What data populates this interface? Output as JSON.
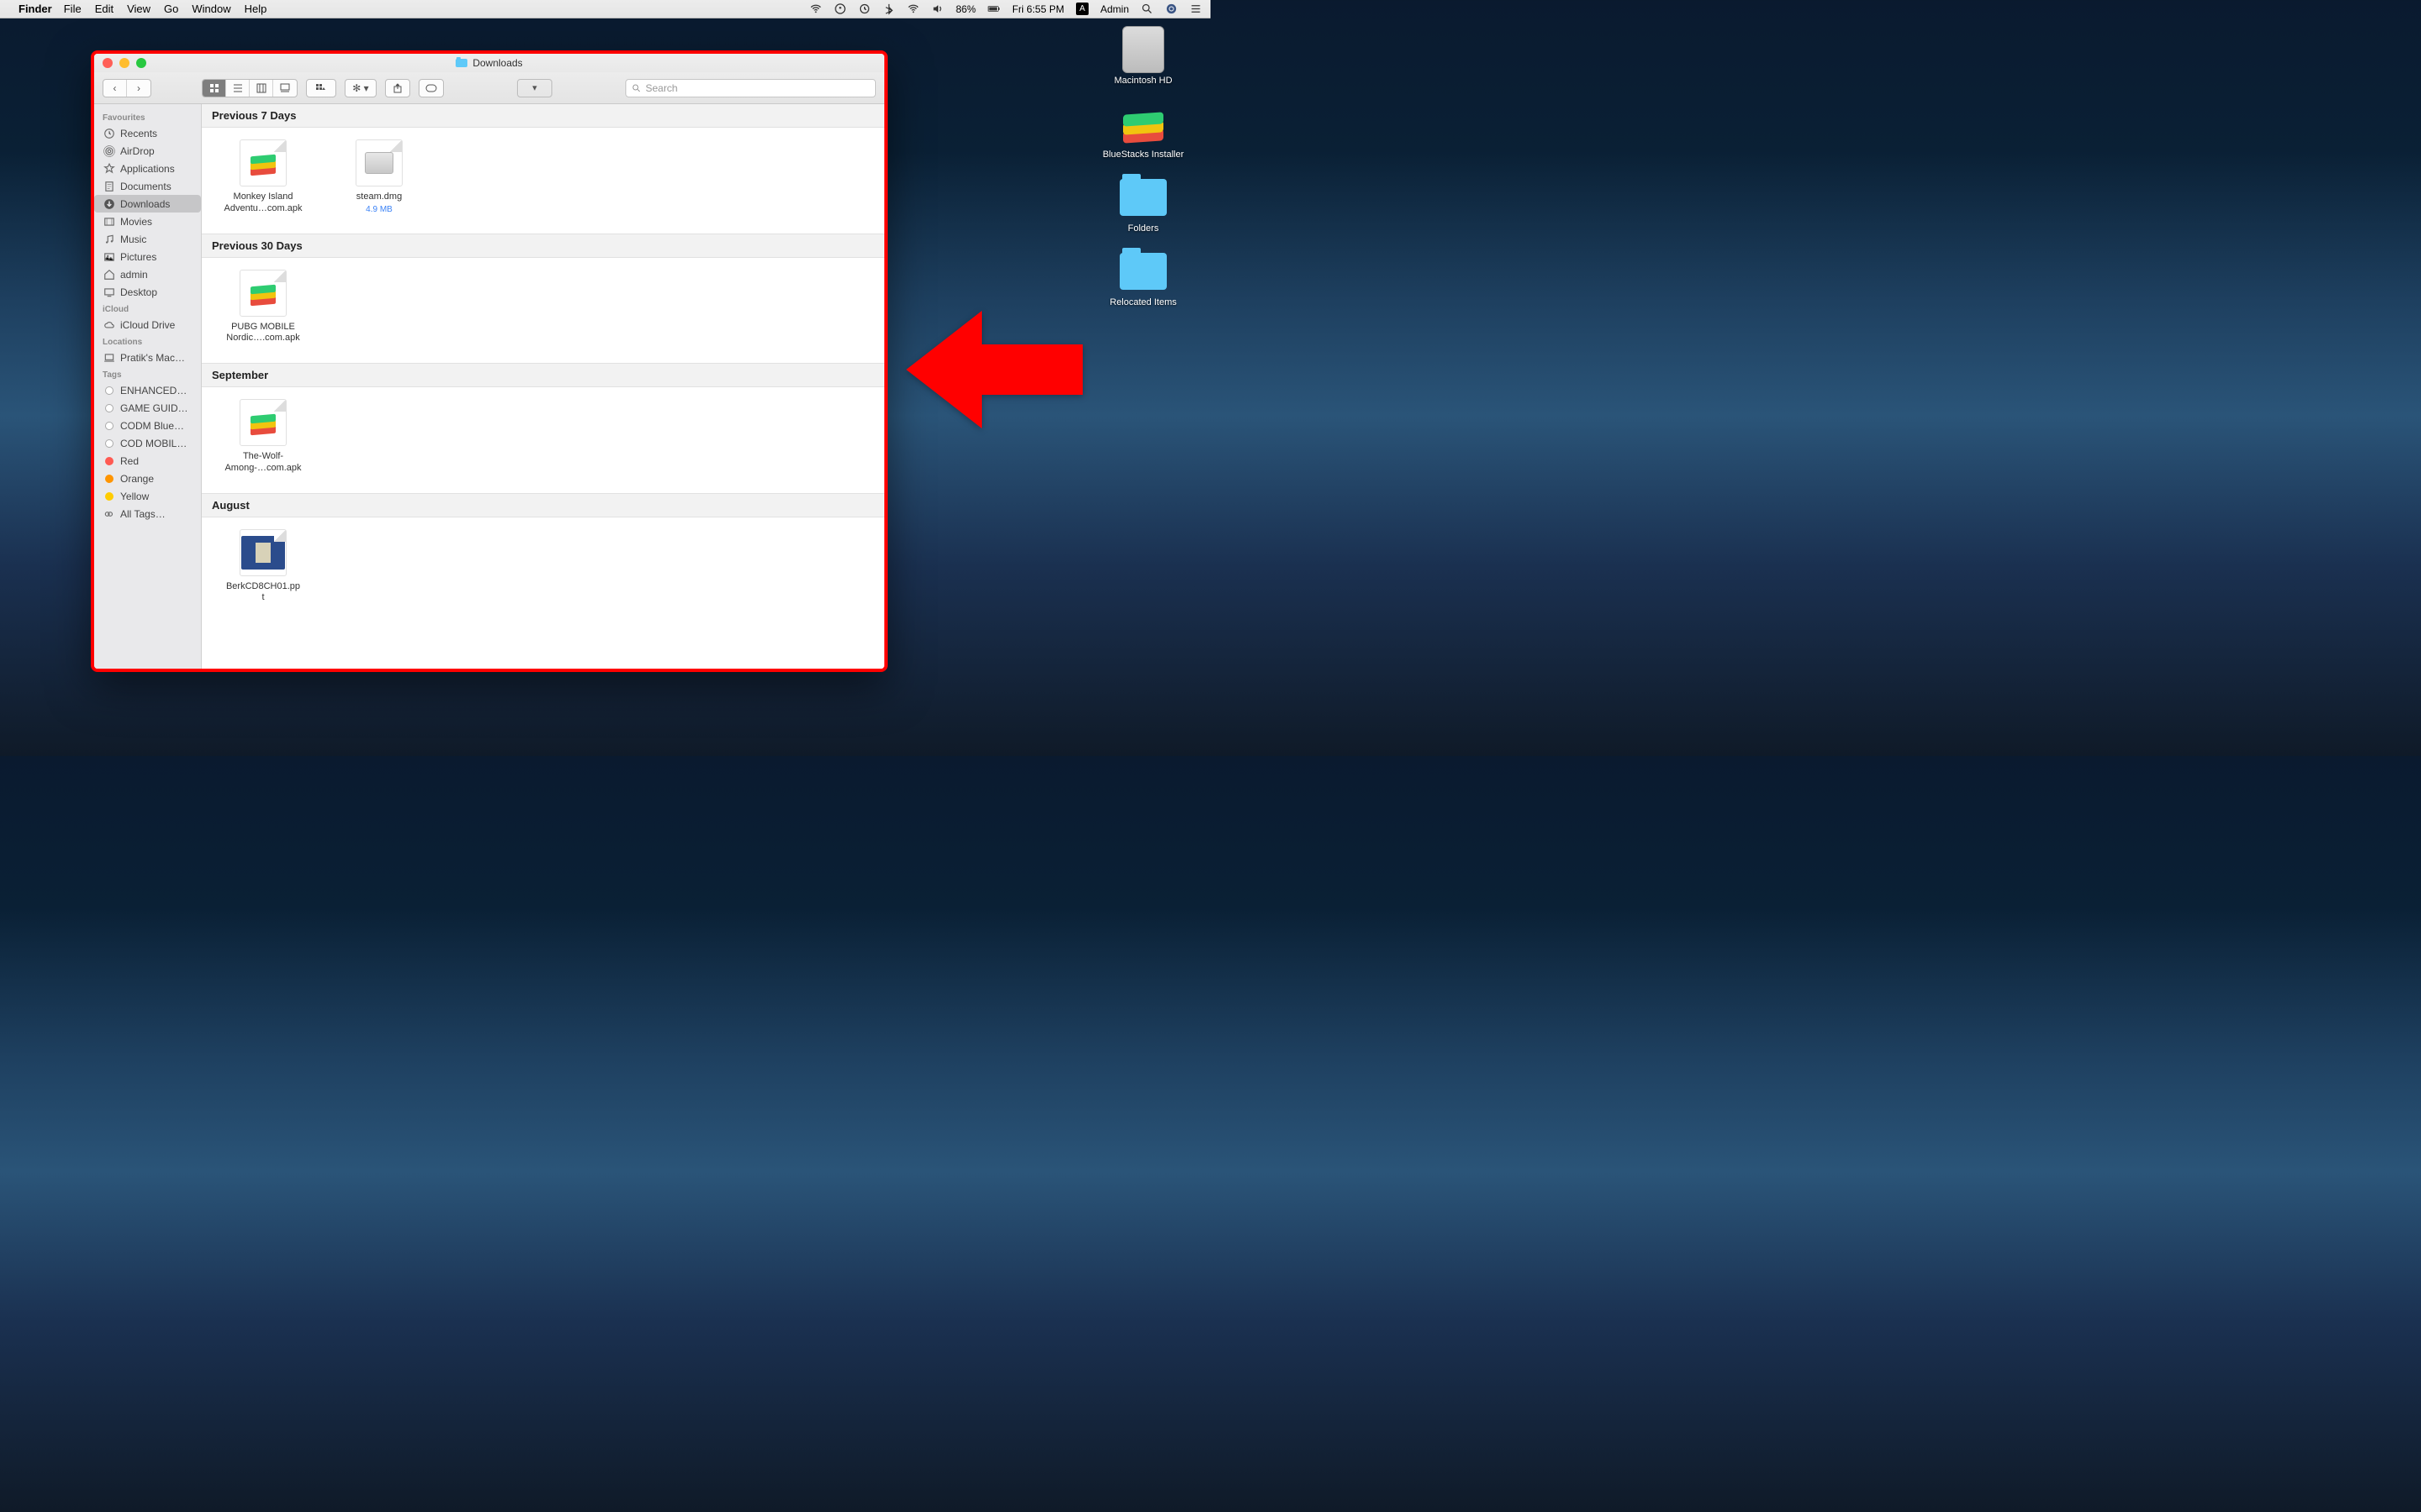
{
  "menubar": {
    "app": "Finder",
    "items": [
      "File",
      "Edit",
      "View",
      "Go",
      "Window",
      "Help"
    ],
    "battery": "86%",
    "clock": "Fri 6:55 PM",
    "user": "Admin"
  },
  "desktop": {
    "items": [
      {
        "label": "Macintosh HD",
        "kind": "hd"
      },
      {
        "label": "BlueStacks Installer",
        "kind": "bs"
      },
      {
        "label": "Folders",
        "kind": "folder"
      },
      {
        "label": "Relocated Items",
        "kind": "folder"
      }
    ]
  },
  "finder": {
    "title": "Downloads",
    "search_placeholder": "Search",
    "sidebar": {
      "sections": [
        {
          "header": "Favourites",
          "items": [
            {
              "label": "Recents",
              "icon": "clock"
            },
            {
              "label": "AirDrop",
              "icon": "airdrop"
            },
            {
              "label": "Applications",
              "icon": "apps"
            },
            {
              "label": "Documents",
              "icon": "doc"
            },
            {
              "label": "Downloads",
              "icon": "down",
              "active": true
            },
            {
              "label": "Movies",
              "icon": "movie"
            },
            {
              "label": "Music",
              "icon": "music"
            },
            {
              "label": "Pictures",
              "icon": "pic"
            },
            {
              "label": "admin",
              "icon": "home"
            },
            {
              "label": "Desktop",
              "icon": "desk"
            }
          ]
        },
        {
          "header": "iCloud",
          "items": [
            {
              "label": "iCloud Drive",
              "icon": "cloud"
            }
          ]
        },
        {
          "header": "Locations",
          "items": [
            {
              "label": "Pratik's Mac…",
              "icon": "laptop"
            }
          ]
        },
        {
          "header": "Tags",
          "items": [
            {
              "label": "ENHANCED…",
              "icon": "tag"
            },
            {
              "label": "GAME GUID…",
              "icon": "tag"
            },
            {
              "label": "CODM Blue…",
              "icon": "tag"
            },
            {
              "label": "COD MOBIL…",
              "icon": "tag"
            },
            {
              "label": "Red",
              "icon": "tag",
              "color": "#ff5a52"
            },
            {
              "label": "Orange",
              "icon": "tag",
              "color": "#ff9500"
            },
            {
              "label": "Yellow",
              "icon": "tag",
              "color": "#ffcc00"
            },
            {
              "label": "All Tags…",
              "icon": "alltags"
            }
          ]
        }
      ]
    },
    "groups": [
      {
        "header": "Previous 7 Days",
        "files": [
          {
            "name": "Monkey Island\nAdventu…com.apk",
            "thumb": "bs"
          },
          {
            "name": "steam.dmg",
            "thumb": "dmg",
            "meta": "4.9 MB"
          }
        ]
      },
      {
        "header": "Previous 30 Days",
        "files": [
          {
            "name": "PUBG MOBILE\nNordic….com.apk",
            "thumb": "bs"
          }
        ]
      },
      {
        "header": "September",
        "files": [
          {
            "name": "The-Wolf-\nAmong-…com.apk",
            "thumb": "bs"
          }
        ]
      },
      {
        "header": "August",
        "files": [
          {
            "name": "BerkCD8CH01.pp\nt",
            "thumb": "ppt"
          }
        ]
      }
    ]
  }
}
